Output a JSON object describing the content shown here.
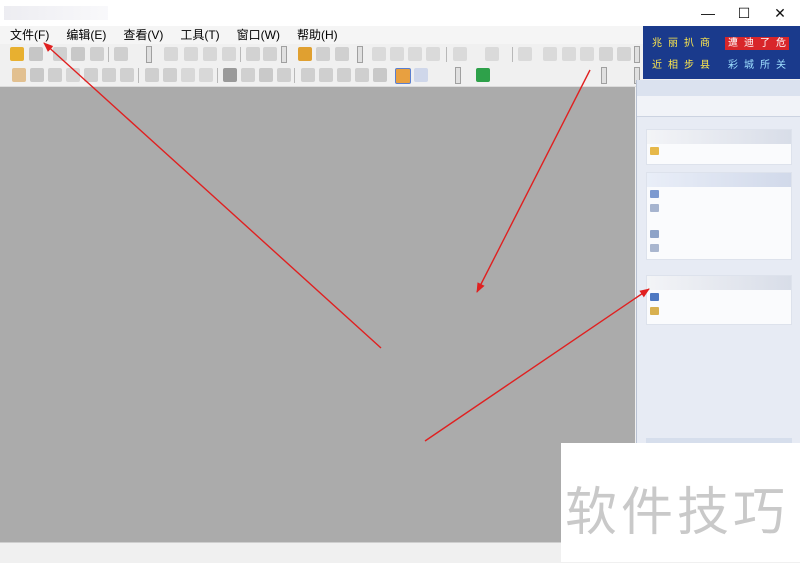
{
  "window": {
    "minimize_glyph": "—",
    "maximize_glyph": "☐",
    "close_glyph": "✕"
  },
  "menu": [
    {
      "label": "文件(F)"
    },
    {
      "label": "编辑(E)"
    },
    {
      "label": "查看(V)"
    },
    {
      "label": "工具(T)"
    },
    {
      "label": "窗口(W)"
    },
    {
      "label": "帮助(H)"
    }
  ],
  "banner": {
    "row1": [
      "兆",
      "丽",
      "扒",
      "商",
      "遭",
      "迪",
      "了",
      "危"
    ],
    "row2": [
      "近",
      "相",
      "步",
      "县",
      "彩",
      "城",
      "所",
      "关"
    ]
  },
  "watermark": {
    "text": "软件技巧"
  },
  "colors": {
    "workspace": "#ababab",
    "arrow": "#e02020",
    "banner_bg": "#1a3a8c",
    "banner_red": "#d8262a"
  }
}
